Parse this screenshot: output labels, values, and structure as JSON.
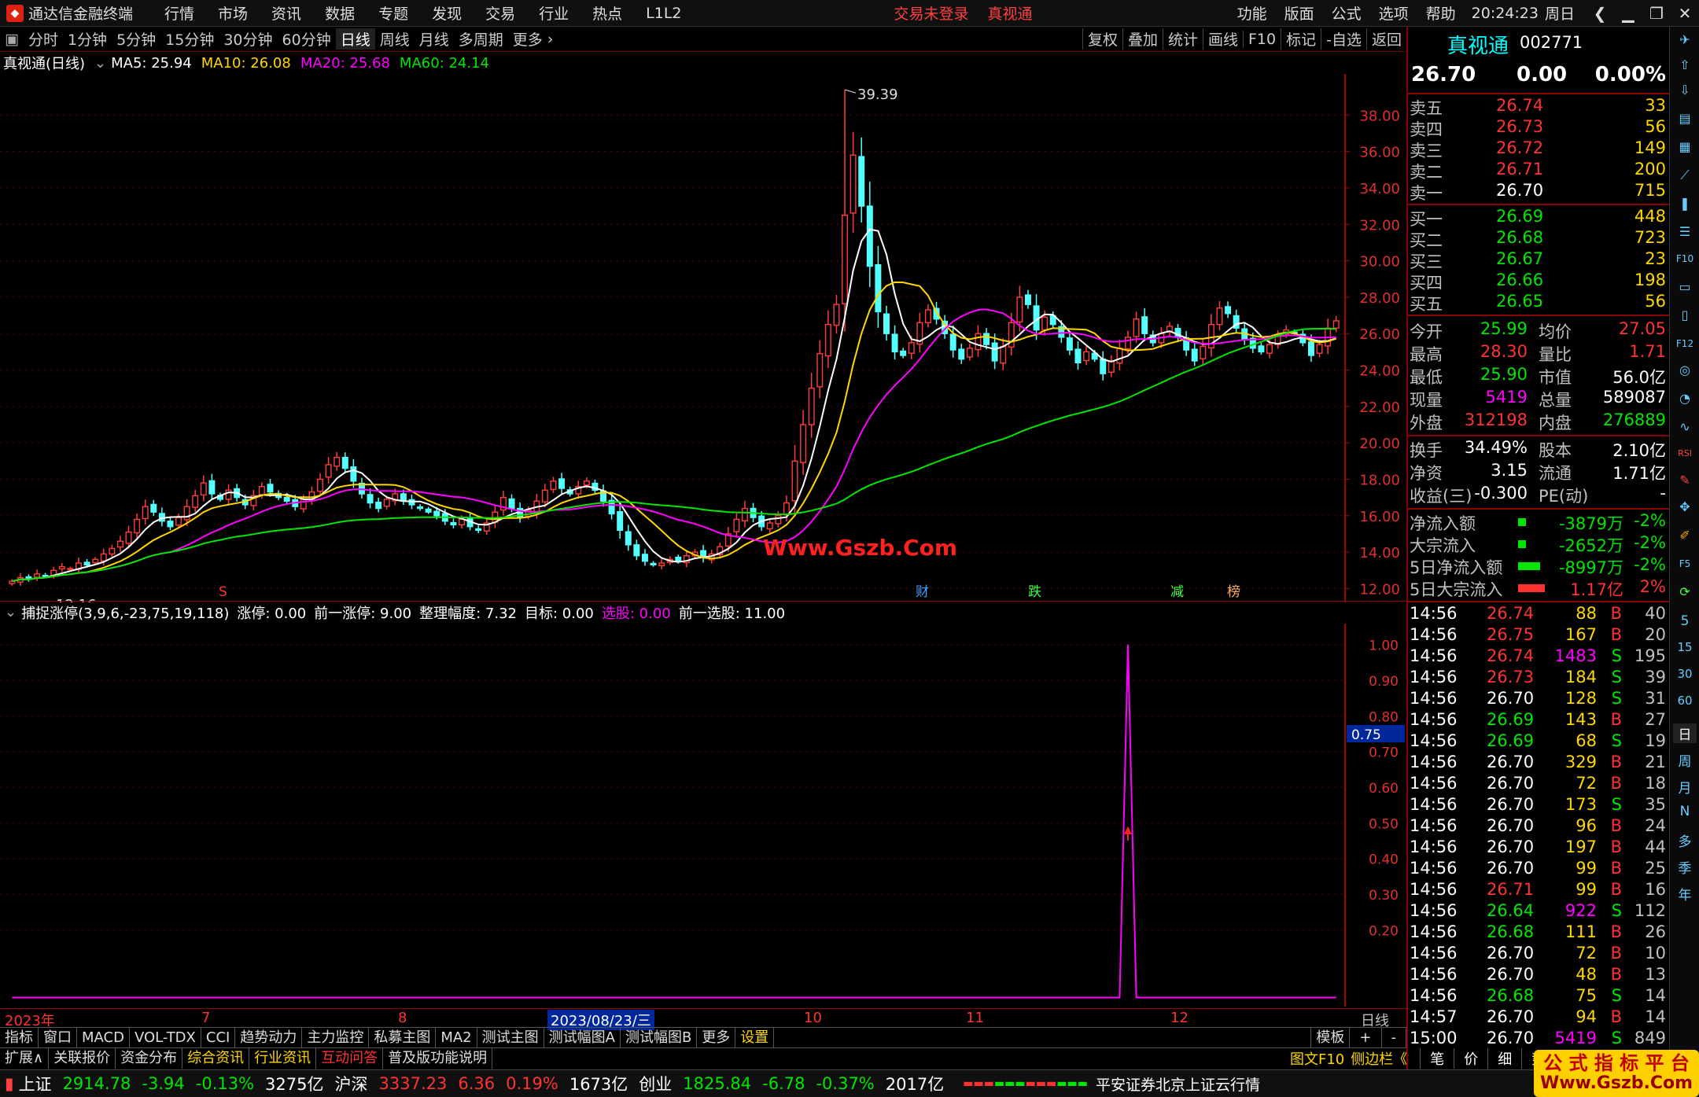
{
  "window": {
    "app_name": "通达信金融终端",
    "menus": [
      "行情",
      "市场",
      "资讯",
      "数据",
      "专题",
      "发现",
      "交易",
      "行业",
      "热点",
      "L1L2"
    ],
    "trade_status": "交易未登录",
    "stock_link": "真视通",
    "right_menus": [
      "功能",
      "版面",
      "公式",
      "选项",
      "帮助"
    ],
    "clock": "20:24:23",
    "weekday": "周日"
  },
  "toolbar": {
    "periods": [
      "分时",
      "1分钟",
      "5分钟",
      "15分钟",
      "30分钟",
      "60分钟",
      "日线",
      "周线",
      "月线",
      "多周期",
      "更多"
    ],
    "active_period": "日线",
    "right_tools": [
      "复权",
      "叠加",
      "统计",
      "画线",
      "F10",
      "标记",
      "-自选",
      "返回"
    ]
  },
  "main_info": {
    "name": "真视通(日线)",
    "ma5": "MA5: 25.94",
    "ma10": "MA10: 26.08",
    "ma20": "MA20: 25.68",
    "ma60": "MA60: 24.14"
  },
  "chart_data": {
    "type": "candlestick",
    "title": "真视通(日线)",
    "y_ticks": [
      "38.00",
      "36.00",
      "34.00",
      "32.00",
      "30.00",
      "28.00",
      "26.00",
      "24.00",
      "22.00",
      "20.00",
      "18.00",
      "16.00",
      "14.00",
      "12.00"
    ],
    "ylim": [
      11.5,
      40
    ],
    "high_label": "39.39",
    "low_label": "12.16",
    "watermark": "Www.Gszb.Com",
    "event_markers": [
      "S",
      "财",
      "跌",
      "减",
      "榜"
    ],
    "close_series": [
      12.4,
      12.6,
      12.5,
      12.8,
      12.7,
      13.0,
      13.2,
      13.1,
      13.4,
      13.3,
      13.6,
      13.9,
      14.2,
      14.6,
      15.1,
      15.8,
      16.5,
      16.2,
      15.7,
      15.4,
      15.9,
      16.5,
      17.1,
      17.8,
      17.2,
      16.9,
      17.4,
      17.0,
      16.6,
      17.1,
      17.6,
      17.3,
      17.0,
      16.8,
      16.5,
      16.9,
      17.3,
      18.0,
      18.8,
      19.2,
      18.6,
      17.9,
      17.2,
      16.7,
      16.4,
      16.9,
      17.2,
      16.8,
      16.6,
      16.4,
      16.2,
      16.0,
      15.7,
      15.5,
      15.8,
      15.4,
      15.2,
      15.6,
      16.2,
      17.0,
      16.4,
      15.9,
      16.3,
      16.8,
      17.4,
      17.9,
      17.5,
      17.2,
      17.6,
      17.9,
      17.4,
      16.8,
      16.1,
      15.2,
      14.4,
      13.8,
      13.5,
      13.3,
      13.4,
      13.6,
      13.5,
      13.8,
      14.0,
      13.7,
      13.9,
      14.3,
      15.0,
      15.8,
      16.4,
      15.9,
      15.4,
      15.6,
      16.0,
      16.7,
      19.0,
      21.0,
      23.0,
      24.9,
      26.5,
      27.6,
      32.5,
      35.8,
      33.0,
      29.7,
      27.2,
      26.0,
      25.0,
      24.8,
      25.5,
      26.6,
      27.3,
      26.8,
      26.0,
      25.1,
      24.6,
      25.2,
      26.0,
      25.4,
      24.5,
      25.3,
      26.6,
      28.0,
      27.6,
      26.2,
      26.9,
      26.5,
      25.8,
      25.1,
      24.4,
      25.0,
      24.6,
      23.8,
      24.5,
      25.2,
      25.8,
      26.8,
      26.0,
      25.5,
      26.0,
      26.4,
      25.8,
      25.1,
      24.5,
      25.3,
      26.5,
      27.4,
      27.1,
      26.3,
      25.7,
      25.2,
      25.0,
      25.4,
      25.9,
      26.2,
      26.0,
      25.5,
      24.8,
      25.4,
      26.3,
      26.7
    ]
  },
  "sub_info": {
    "name": "捕捉涨停(3,9,6,-23,75,19,118)",
    "zt": "涨停: 0.00",
    "qzt": "前一涨停: 9.00",
    "zlfd": "整理幅度: 7.32",
    "mb": "目标: 0.00",
    "xg": "选股: 0.00",
    "qxg": "前一选股: 11.00"
  },
  "sub_chart": {
    "y_ticks": [
      "1.00",
      "0.90",
      "0.80",
      "0.70",
      "0.60",
      "0.50",
      "0.40",
      "0.30",
      "0.20"
    ],
    "ylim": [
      0,
      1.05
    ],
    "cursor_value": "0.75",
    "spike_index": 134,
    "spike_value": 1.0
  },
  "date_axis": {
    "labels": [
      "2023年",
      "7",
      "8",
      "2023/08/23/三",
      "10",
      "11",
      "12"
    ],
    "period_label": "日线"
  },
  "tabs1": {
    "items": [
      "指标",
      "窗口",
      "MACD",
      "VOL-TDX",
      "CCI",
      "趋势动力",
      "主力监控",
      "私募主图",
      "MA2",
      "测试主图",
      "测试幅图A",
      "测试幅图B",
      "更多",
      "设置"
    ],
    "right": [
      "模板",
      "+",
      "-"
    ]
  },
  "tabs2": {
    "items": [
      "扩展∧",
      "关联报价",
      "资金分布",
      "综合资讯",
      "行业资讯",
      "互动问答",
      "普及版功能说明"
    ],
    "right": [
      "图文F10",
      "侧边栏《",
      "笔",
      "价",
      "细",
      "势"
    ]
  },
  "status": {
    "indices": [
      {
        "name": "上证",
        "value": "2914.78",
        "chg": "-3.94",
        "pct": "-0.13%",
        "amt": "3275亿"
      },
      {
        "name": "沪深",
        "value": "3337.23",
        "chg": "6.36",
        "pct": "0.19%",
        "amt": "1673亿"
      },
      {
        "name": "创业",
        "value": "1825.84",
        "chg": "-6.78",
        "pct": "-0.37%",
        "amt": "2017亿"
      }
    ],
    "server": "平安证券北京上证云行情"
  },
  "quote": {
    "name": "真视通",
    "code": "002771",
    "price": "26.70",
    "change": "0.00",
    "pct": "0.00%",
    "sells": [
      {
        "label": "卖五",
        "price": "26.74",
        "vol": "33"
      },
      {
        "label": "卖四",
        "price": "26.73",
        "vol": "56"
      },
      {
        "label": "卖三",
        "price": "26.72",
        "vol": "149"
      },
      {
        "label": "卖二",
        "price": "26.71",
        "vol": "200"
      },
      {
        "label": "卖一",
        "price": "26.70",
        "vol": "715"
      }
    ],
    "buys": [
      {
        "label": "买一",
        "price": "26.69",
        "vol": "448"
      },
      {
        "label": "买二",
        "price": "26.68",
        "vol": "723"
      },
      {
        "label": "买三",
        "price": "26.67",
        "vol": "23"
      },
      {
        "label": "买四",
        "price": "26.66",
        "vol": "198"
      },
      {
        "label": "买五",
        "price": "26.65",
        "vol": "56"
      }
    ],
    "stats": [
      [
        "今开",
        "25.99",
        "均价",
        "27.05"
      ],
      [
        "最高",
        "28.30",
        "量比",
        "1.71"
      ],
      [
        "最低",
        "25.90",
        "市值",
        "56.0亿"
      ],
      [
        "现量",
        "5419",
        "总量",
        "589087"
      ],
      [
        "外盘",
        "312198",
        "内盘",
        "276889"
      ]
    ],
    "stats2": [
      [
        "换手",
        "34.49%",
        "股本",
        "2.10亿"
      ],
      [
        "净资",
        "3.15",
        "流通",
        "1.71亿"
      ],
      [
        "收益(三)",
        "-0.300",
        "PE(动)",
        "-"
      ]
    ],
    "flows": [
      {
        "label": "净流入额",
        "value": "-3879万",
        "pct": "-2%"
      },
      {
        "label": "大宗流入",
        "value": "-2652万",
        "pct": "-2%"
      },
      {
        "label": "5日净流入额",
        "value": "-8997万",
        "pct": "-2%"
      },
      {
        "label": "5日大宗流入",
        "value": "1.17亿",
        "pct": "2%"
      }
    ],
    "ticks": [
      [
        "14:56",
        "26.74",
        "88",
        "B",
        "40"
      ],
      [
        "14:56",
        "26.75",
        "167",
        "B",
        "20"
      ],
      [
        "14:56",
        "26.74",
        "1483",
        "S",
        "195"
      ],
      [
        "14:56",
        "26.73",
        "184",
        "S",
        "39"
      ],
      [
        "14:56",
        "26.70",
        "128",
        "S",
        "31"
      ],
      [
        "14:56",
        "26.69",
        "143",
        "B",
        "27"
      ],
      [
        "14:56",
        "26.69",
        "68",
        "S",
        "19"
      ],
      [
        "14:56",
        "26.70",
        "329",
        "B",
        "21"
      ],
      [
        "14:56",
        "26.70",
        "72",
        "B",
        "18"
      ],
      [
        "14:56",
        "26.70",
        "173",
        "S",
        "35"
      ],
      [
        "14:56",
        "26.70",
        "96",
        "B",
        "24"
      ],
      [
        "14:56",
        "26.70",
        "197",
        "B",
        "44"
      ],
      [
        "14:56",
        "26.70",
        "99",
        "B",
        "25"
      ],
      [
        "14:56",
        "26.71",
        "99",
        "B",
        "16"
      ],
      [
        "14:56",
        "26.64",
        "922",
        "S",
        "112"
      ],
      [
        "14:56",
        "26.68",
        "111",
        "B",
        "26"
      ],
      [
        "14:56",
        "26.70",
        "72",
        "B",
        "10"
      ],
      [
        "14:56",
        "26.70",
        "48",
        "B",
        "13"
      ],
      [
        "14:56",
        "26.68",
        "75",
        "S",
        "14"
      ],
      [
        "14:57",
        "26.70",
        "94",
        "B",
        "14"
      ],
      [
        "15:00",
        "26.70",
        "5419",
        "S",
        "849"
      ]
    ]
  },
  "sidestrip": {
    "labels": [
      "日",
      "周",
      "月",
      "N",
      "多",
      "季",
      "年"
    ],
    "icons": [
      "BS",
      "RSI",
      "F10",
      "F5",
      "15",
      "30",
      "60"
    ]
  },
  "watermark": {
    "line1": "公 式 指 标 平 台",
    "line2": "Www.Gszb.Com"
  }
}
